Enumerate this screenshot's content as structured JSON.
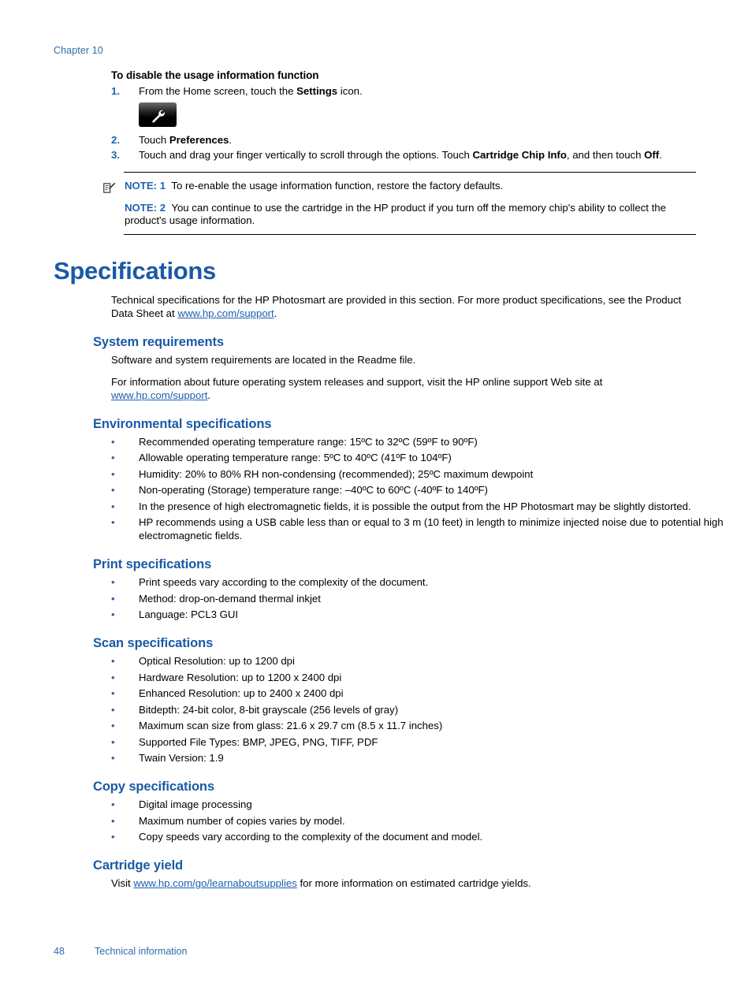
{
  "header": {
    "chapter": "Chapter 10"
  },
  "procedure": {
    "title": "To disable the usage information function",
    "steps": [
      {
        "num": "1.",
        "text_before": "From the Home screen, touch the ",
        "bold": "Settings",
        "text_after": " icon."
      },
      {
        "num": "2.",
        "text_before": "Touch ",
        "bold": "Preferences",
        "text_after": "."
      },
      {
        "num": "3.",
        "text_before": "Touch and drag your finger vertically to scroll through the options. Touch ",
        "bold": "Cartridge Chip Info",
        "text_after": ", and then touch ",
        "bold2": "Off",
        "text_end": "."
      }
    ],
    "settings_icon_name": "wrench-icon"
  },
  "notes": [
    {
      "label": "NOTE: 1",
      "text": "To re-enable the usage information function, restore the factory defaults."
    },
    {
      "label": "NOTE: 2",
      "text": "You can continue to use the cartridge in the HP product if you turn off the memory chip's ability to collect the product's usage information."
    }
  ],
  "section": {
    "title": "Specifications",
    "intro_before": "Technical specifications for the HP Photosmart are provided in this section. For more product specifications, see the Product Data Sheet at ",
    "intro_link": "www.hp.com/support",
    "intro_after": "."
  },
  "system_requirements": {
    "title": "System requirements",
    "para1": "Software and system requirements are located in the Readme file.",
    "para2_before": "For information about future operating system releases and support, visit the HP online support Web site at ",
    "para2_link": "www.hp.com/support",
    "para2_after": "."
  },
  "environmental": {
    "title": "Environmental specifications",
    "items": [
      "Recommended operating temperature range: 15ºC to 32ºC (59ºF to 90ºF)",
      "Allowable operating temperature range: 5ºC to 40ºC (41ºF to 104ºF)",
      "Humidity: 20% to 80% RH non-condensing (recommended); 25ºC maximum dewpoint",
      "Non-operating (Storage) temperature range: –40ºC to 60ºC (-40ºF to 140ºF)",
      "In the presence of high electromagnetic fields, it is possible the output from the HP Photosmart may be slightly distorted.",
      "HP recommends using a USB cable less than or equal to 3 m (10 feet) in length to minimize injected noise due to potential high electromagnetic fields."
    ]
  },
  "print_specs": {
    "title": "Print specifications",
    "items": [
      "Print speeds vary according to the complexity of the document.",
      "Method: drop-on-demand thermal inkjet",
      "Language: PCL3 GUI"
    ]
  },
  "scan_specs": {
    "title": "Scan specifications",
    "items": [
      "Optical Resolution: up to 1200 dpi",
      "Hardware Resolution: up to 1200 x 2400 dpi",
      "Enhanced Resolution: up to 2400 x 2400 dpi",
      "Bitdepth: 24-bit color, 8-bit grayscale (256 levels of gray)",
      "Maximum scan size from glass: 21.6 x 29.7 cm (8.5 x 11.7 inches)",
      "Supported File Types: BMP, JPEG, PNG, TIFF, PDF",
      "Twain Version: 1.9"
    ]
  },
  "copy_specs": {
    "title": "Copy specifications",
    "items": [
      "Digital image processing",
      "Maximum number of copies varies by model.",
      "Copy speeds vary according to the complexity of the document and model."
    ]
  },
  "cartridge_yield": {
    "title": "Cartridge yield",
    "text_before": "Visit ",
    "link": "www.hp.com/go/learnaboutsupplies",
    "text_after": " for more information on estimated cartridge yields."
  },
  "footer": {
    "page_number": "48",
    "section_label": "Technical information"
  },
  "bullet_glyph": "•",
  "colors": {
    "heading_blue": "#1a5aa5",
    "link_blue": "#1e5fae",
    "header_blue": "#2f6aaf",
    "bullet_blue": "#2a62a8"
  }
}
